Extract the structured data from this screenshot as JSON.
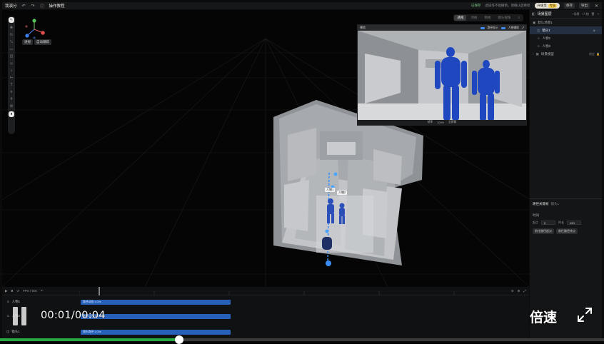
{
  "topbar": {
    "title": "我演分",
    "tutorial": "操作教程",
    "autosave": "已保存",
    "hint": "此操作不能撤销，请确认后继续",
    "pill_label": "升级至",
    "pill_tag": "专业",
    "save": "保存",
    "export": "导出"
  },
  "viewport": {
    "chip_perspective": "透视",
    "chip_follow": "自动跟踪",
    "view_modes": [
      "透视",
      "顶视",
      "侧视",
      "镜头视角"
    ],
    "active_view_mode": 0,
    "character_labels": [
      "人物1",
      "人物2"
    ]
  },
  "preview": {
    "title": "预览",
    "toggle_path": "路径显示",
    "toggle_guide": "人物辅助",
    "footer_items": [
      "帧率",
      "100%",
      "全屏幕"
    ]
  },
  "scene_tree": {
    "title": "场景图层",
    "header_actions": [
      "+场景",
      "+人物"
    ],
    "items": [
      {
        "label": "默认场景1",
        "icon": "folder-icon",
        "selected": false
      },
      {
        "label": "镜头1",
        "icon": "camera-icon",
        "selected": true
      },
      {
        "label": "人物1",
        "icon": "person-icon",
        "selected": false
      },
      {
        "label": "人物2",
        "icon": "person-icon",
        "selected": false
      },
      {
        "label": "场景模型",
        "icon": "cube-icon",
        "selected": false,
        "badge": "锁定"
      }
    ]
  },
  "inspector": {
    "title": "路径关键帧",
    "subtitle": "镜头1",
    "section": "时间",
    "start_label": "起点",
    "start_value": "0",
    "duration_label": "时长",
    "duration_value": "120",
    "btn_prev": "前往路径起点",
    "btn_next": "前往路径终点"
  },
  "timeline": {
    "fps_label": "FPS / 60s",
    "tracks": [
      {
        "name": "人物1",
        "clip": "路径动画 1.00s"
      },
      {
        "name": "人物2",
        "clip": "路径动画 1.00s"
      },
      {
        "name": "镜头1",
        "clip": "镜头路径 1.00s"
      }
    ]
  },
  "video": {
    "timecode": "00:01/00:04",
    "speed_label": "倍速",
    "progress_fraction": 0.297
  },
  "colors": {
    "accent": "#2a7cf6",
    "progress": "#29a843",
    "character": "#2a4fb8"
  }
}
